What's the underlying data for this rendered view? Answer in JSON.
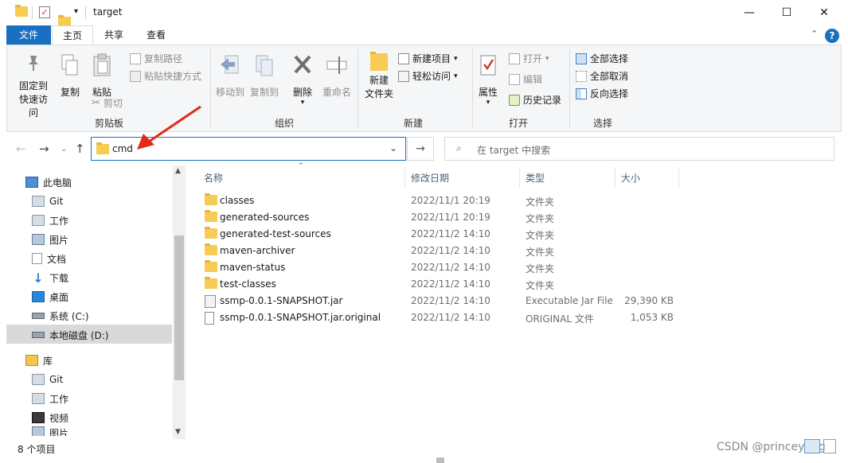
{
  "title": "target",
  "tabs": {
    "file": "文件",
    "home": "主页",
    "share": "共享",
    "view": "查看"
  },
  "ribbon": {
    "clipboard": {
      "label": "剪贴板",
      "pin": "固定到快速访问",
      "copy": "复制",
      "paste": "粘贴",
      "copy_path": "复制路径",
      "paste_shortcut": "粘贴快捷方式",
      "cut": "剪切"
    },
    "organize": {
      "label": "组织",
      "move_to": "移动到",
      "copy_to": "复制到",
      "delete": "删除",
      "rename": "重命名"
    },
    "new": {
      "label": "新建",
      "new_folder": "新建\n文件夹",
      "new_item": "新建项目",
      "easy_access": "轻松访问"
    },
    "open": {
      "label": "打开",
      "properties": "属性",
      "open": "打开",
      "edit": "编辑",
      "history": "历史记录"
    },
    "select": {
      "label": "选择",
      "select_all": "全部选择",
      "select_none": "全部取消",
      "invert": "反向选择"
    }
  },
  "address": {
    "value": "cmd"
  },
  "search": {
    "placeholder": "在 target 中搜索"
  },
  "nav": {
    "items": [
      {
        "label": "此电脑",
        "icon": "pc-icon"
      },
      {
        "label": "Git",
        "icon": "network-folder-icon"
      },
      {
        "label": "工作",
        "icon": "network-folder-icon"
      },
      {
        "label": "图片",
        "icon": "pictures-icon"
      },
      {
        "label": "文档",
        "icon": "documents-icon"
      },
      {
        "label": "下载",
        "icon": "download-icon"
      },
      {
        "label": "桌面",
        "icon": "desktop-icon"
      },
      {
        "label": "系统 (C:)",
        "icon": "drive-icon"
      },
      {
        "label": "本地磁盘 (D:)",
        "icon": "drive-icon"
      },
      {
        "label": "库",
        "icon": "library-icon"
      },
      {
        "label": "Git",
        "icon": "network-folder-icon"
      },
      {
        "label": "工作",
        "icon": "network-folder-icon"
      },
      {
        "label": "视频",
        "icon": "video-icon"
      },
      {
        "label": "图片",
        "icon": "pictures-icon"
      }
    ]
  },
  "columns": {
    "name": "名称",
    "modified": "修改日期",
    "type": "类型",
    "size": "大小"
  },
  "files": [
    {
      "name": "classes",
      "date": "2022/11/1 20:19",
      "type": "文件夹",
      "size": "",
      "icon": "folder-icon"
    },
    {
      "name": "generated-sources",
      "date": "2022/11/1 20:19",
      "type": "文件夹",
      "size": "",
      "icon": "folder-icon"
    },
    {
      "name": "generated-test-sources",
      "date": "2022/11/2 14:10",
      "type": "文件夹",
      "size": "",
      "icon": "folder-icon"
    },
    {
      "name": "maven-archiver",
      "date": "2022/11/2 14:10",
      "type": "文件夹",
      "size": "",
      "icon": "folder-icon"
    },
    {
      "name": "maven-status",
      "date": "2022/11/2 14:10",
      "type": "文件夹",
      "size": "",
      "icon": "folder-icon"
    },
    {
      "name": "test-classes",
      "date": "2022/11/2 14:10",
      "type": "文件夹",
      "size": "",
      "icon": "folder-icon"
    },
    {
      "name": "ssmp-0.0.1-SNAPSHOT.jar",
      "date": "2022/11/2 14:10",
      "type": "Executable Jar File",
      "size": "29,390 KB",
      "icon": "jar-file-icon"
    },
    {
      "name": "ssmp-0.0.1-SNAPSHOT.jar.original",
      "date": "2022/11/2 14:10",
      "type": "ORIGINAL 文件",
      "size": "1,053 KB",
      "icon": "file-icon"
    }
  ],
  "status": {
    "count": "8 个项目"
  },
  "watermark": "CSDN @princeyang",
  "colors": {
    "accent": "#1a6fc3",
    "folder": "#f6cc53",
    "annotation_arrow": "#e02a1a"
  }
}
